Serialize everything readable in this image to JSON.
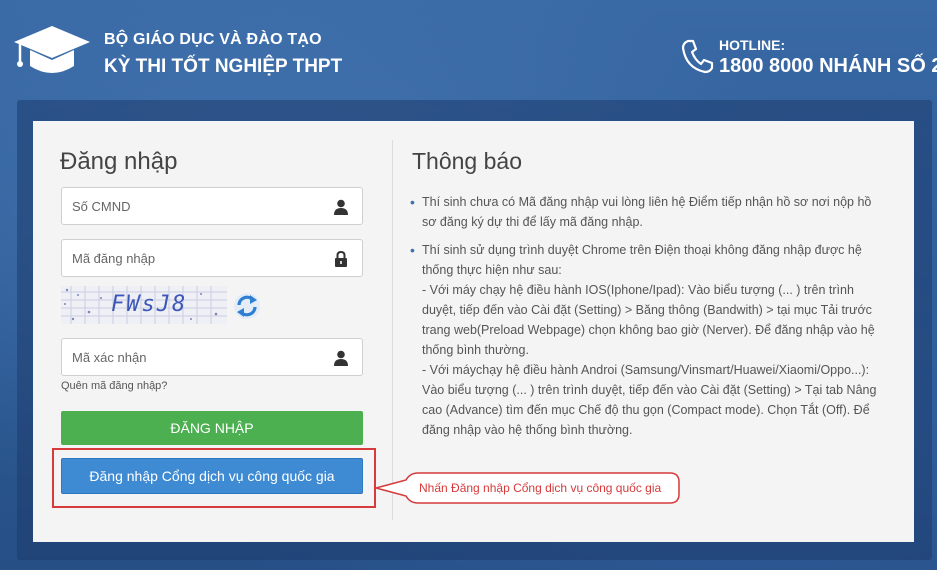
{
  "header": {
    "org_title": "BỘ GIÁO DỤC VÀ ĐÀO TẠO",
    "exam_title": "KỲ THI TỐT NGHIỆP THPT",
    "hotline_label": "HOTLINE:",
    "hotline_number": "1800 8000 NHÁNH SỐ 2"
  },
  "login": {
    "title": "Đăng nhập",
    "id_placeholder": "Số CMND",
    "code_placeholder": "Mã đăng nhập",
    "captcha_text": "FWsJ8",
    "captcha_placeholder": "Mã xác nhận",
    "forgot_link": "Quên mã đăng nhập?",
    "login_button": "ĐĂNG NHẬP",
    "gov_button": "Đăng nhập Cổng dịch vụ công quốc gia"
  },
  "notice": {
    "title": "Thông báo",
    "items": [
      "Thí sinh chưa có Mã đăng nhập vui lòng liên hệ Điểm tiếp nhận hồ sơ nơi nộp hồ sơ đăng ký dự thi để lấy mã đăng nhập.",
      "Thí sinh sử dụng trình duyệt Chrome trên Điện thoại không đăng nhập được hệ thống thực hiện như sau:"
    ],
    "sub_items": [
      " - Với máy chạy hệ điều hành IOS(Iphone/Ipad): Vào biểu tượng (... ) trên trình duyệt, tiếp đến vào Cài đặt (Setting) > Băng thông (Bandwith) > tại mục Tải trước trang web(Preload Webpage) chọn không bao giờ (Nerver). Để đăng nhập vào hệ thống bình thường.",
      " - Với máychạy hệ điều hành Androi (Samsung/Vinsmart/Huawei/Xiaomi/Oppo...): Vào biểu tượng (... ) trên trình duyệt, tiếp đến vào Cài đặt (Setting) > Tại tab Nâng cao (Advance) tìm đến mục Chế độ thu gọn (Compact mode). Chọn Tắt (Off). Để đăng nhập vào hệ thống bình thường."
    ]
  },
  "annotation": {
    "text": "Nhấn Đăng nhập Cổng dịch vụ công quốc gia",
    "color": "#d63a3a"
  },
  "icons": {
    "logo": "graduation-cap-icon",
    "phone": "phone-icon",
    "user": "user-icon",
    "lock": "lock-icon",
    "refresh": "refresh-icon"
  },
  "colors": {
    "login_button": "#4caf50",
    "gov_button": "#3f8bd3",
    "highlight": "#d63a3a"
  }
}
